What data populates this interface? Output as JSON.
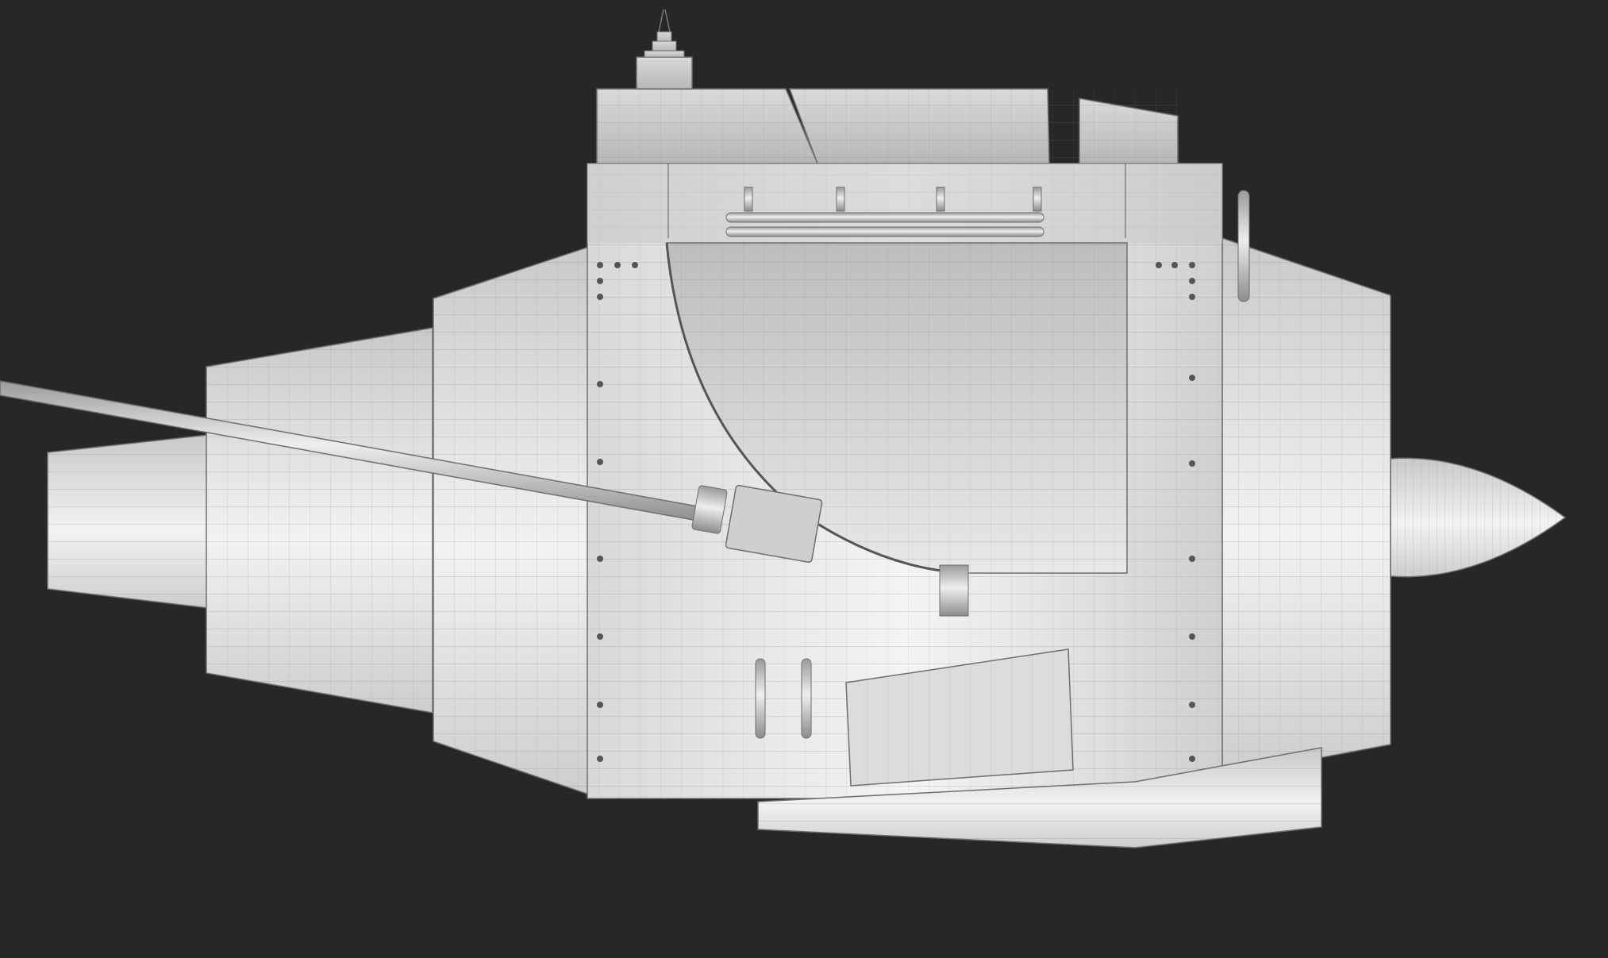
{
  "viewport": {
    "background": "#272727",
    "shading": "grayscale-wireframe",
    "object": "jet-engine-nacelle-model",
    "parts": [
      "nozzle-cone",
      "rear-nacelle",
      "mid-nacelle",
      "core-frame",
      "top-housing",
      "intake-scoop",
      "front-nacelle",
      "nose-spinner",
      "bottom-fairing",
      "lower-access-hatch",
      "hydraulic-lines",
      "fuel-line-with-connector",
      "top-mount-stack"
    ],
    "colors": {
      "light": "#f4f4f4",
      "mid": "#cfcfcf",
      "dark": "#8a8a8a",
      "wire": "#6e6e6e"
    }
  }
}
